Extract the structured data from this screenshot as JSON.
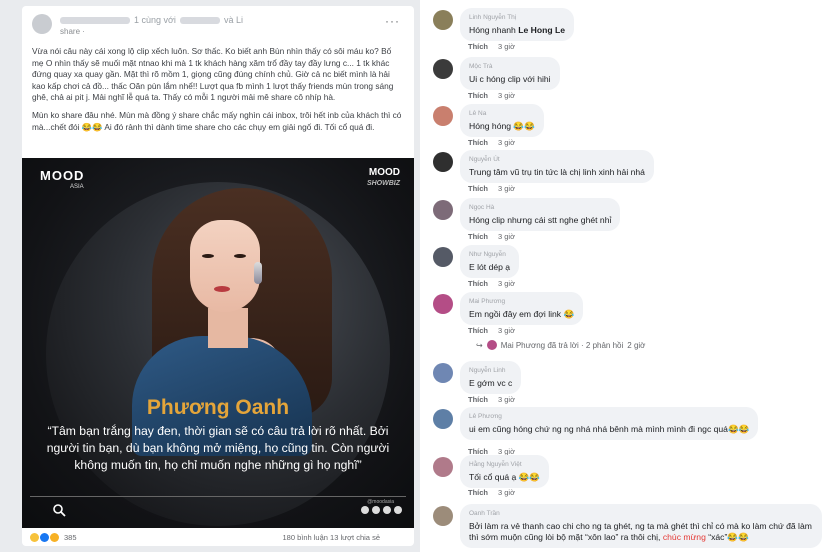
{
  "post": {
    "author_suffix": "1 cùng với",
    "author_with": "và Li",
    "meta": "share ·",
    "more": "···",
    "paragraphs": [
      "Vừa nói câu này cái xong lộ clip xếch luôn. Sơ thấc. Ko biết anh Bùn nhìn thấy có sôi máu ko? Bố mẹ O nhìn thấy sẽ muối mặt ntnao khi mà 1 tk khách hàng xăm trổ đầy tay đầy lưng c... 1 tk khác đứng quay xa quay gần. Mặt thì rõ mồm 1, giọng cũng đúng chính chủ. Giờ cả nc biết mình là hải kao kấp chơi cả đồ... thấc Oăn pùn lắm nhể!! Lượt qua fb mình 1 lượt thấy friends mùn trong sáng ghê, chả ai pit j. Mải nghĩ lễ quá ta. Thấy có mỗi 1 người mải mê share cô nhíp hà.",
      "Mùn ko share đâu nhé. Mùn mà đồng ý share chắc mấy nghìn cái inbox, trôi hết inb của khách thì có mà...chết đói 😂😂 Ai đó rảnh thì dành time share cho các chụy em giải ngố đi. Tối cổ quá đi."
    ],
    "hero": {
      "logo": "MOOD",
      "logo_sub": "ASIA",
      "logo_right": "MOOD",
      "logo_right_sub": "SHOWBIZ",
      "name": "Phương Oanh",
      "quote": "“Tâm bạn trắng hay đen, thời gian sẽ có câu trả lời rõ nhất. Bởi người tin bạn, dù bạn không mở miệng, họ cũng tin. Còn người không muốn tin, họ chỉ muốn nghe những gì họ nghĩ”",
      "handle": "@moodasia"
    },
    "reaction_count": "385",
    "stats": "180 bình luận  13 lượt chia sẻ"
  },
  "comments": [
    {
      "name": "Linh Nguyễn Thị",
      "text": "Hóng nhanh ",
      "mention": "Le Hong Le",
      "act_like": "Thích",
      "act_time": "3 giờ",
      "avatar_color": "#8a7f5a"
    },
    {
      "name": "Mộc Trà",
      "text": "Ui c hóng clip với hihi",
      "act_like": "Thích",
      "act_time": "3 giờ",
      "avatar_color": "#3b3b3b"
    },
    {
      "name": "Lê Na",
      "text": "Hóng hóng 😂😂",
      "act_like": "Thích",
      "act_time": "3 giờ",
      "avatar_color": "#c97f6e"
    },
    {
      "name": "Nguyễn Út",
      "text": "Trung tâm vũ trụ tin tức là chị linh xinh hải nhá",
      "act_like": "Thích",
      "act_time": "3 giờ",
      "avatar_color": "#2f2f2f"
    },
    {
      "name": "Ngọc Hà",
      "text": "Hóng clip nhưng cái stt nghe ghét nhỉ",
      "act_like": "Thích",
      "act_time": "3 giờ",
      "avatar_color": "#7d6b78"
    },
    {
      "name": "Như Nguyễn",
      "text": "E lót dép ạ",
      "act_like": "Thích",
      "act_time": "3 giờ",
      "avatar_color": "#555a66"
    },
    {
      "name": "Mai Phương",
      "text": "Em ngồi đây em đợi link 😂",
      "act_like": "Thích",
      "act_time": "3 giờ",
      "avatar_color": "#b44d86"
    },
    {
      "name": "Nguyễn Linh",
      "text": "E gớm vc c",
      "act_like": "Thích",
      "act_time": "3 giờ",
      "avatar_color": "#6f87b3"
    },
    {
      "name": "Lê Phương",
      "text": "ui em cũng hóng chứ ng ng nhá nhá bênh mà mình mình đi ngc quá😂😂",
      "act_like": "Thích",
      "act_time": "3 giờ",
      "avatar_color": "#5e7fa6"
    },
    {
      "name": "Hằng Nguyễn Việt",
      "text": "Tối cổ quá ạ 😂😂",
      "act_like": "Thích",
      "act_time": "3 giờ",
      "avatar_color": "#b07a8a"
    },
    {
      "name": "Oanh Trần",
      "text": "Bởi làm ra vẻ thanh cao chi cho ng ta ghét, ng ta mà ghét thì chỉ có mà ko làm chứ đã làm thì sớm muộn cũng lòi bộ mặt “xôn lao” ra thôi chị, ",
      "highlight": "chúc mừng",
      "tail": " “xác”😂😂",
      "avatar_color": "#9c8c7a"
    }
  ],
  "reply_summary": "Mai Phương đã trả lời · 2 phản hồi",
  "reply_time": "2 giờ",
  "colors": {
    "accent_name": "#e4a53a",
    "highlight": "#e53935",
    "bubble": "#f0f2f5"
  }
}
